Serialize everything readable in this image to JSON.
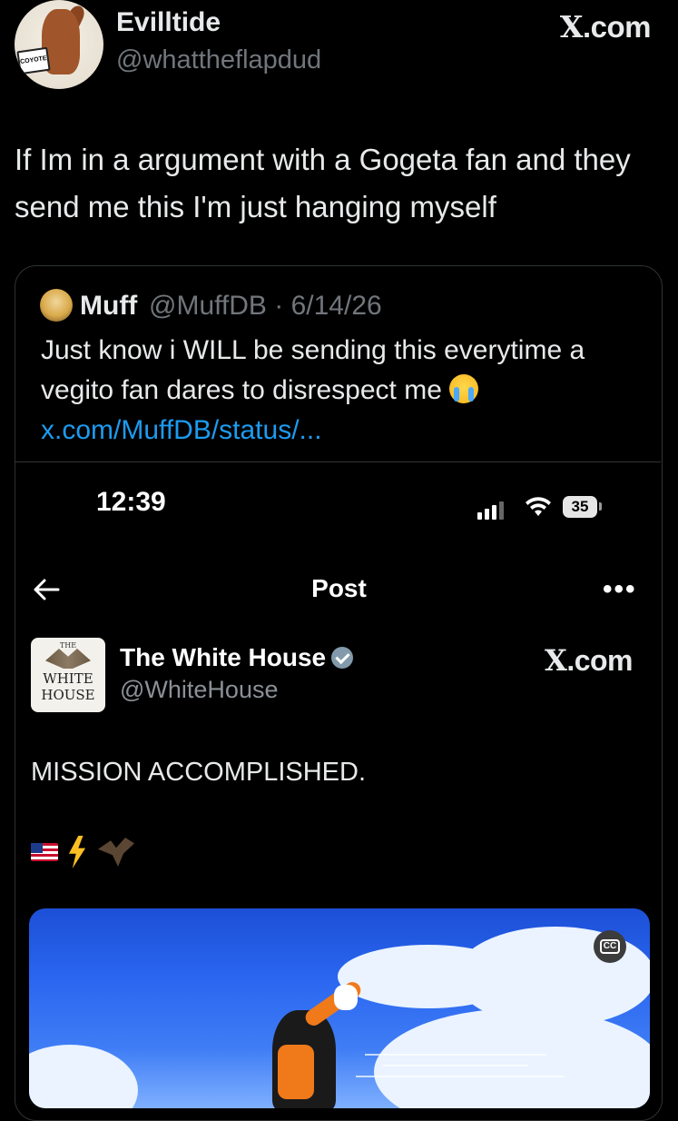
{
  "outer_tweet": {
    "display_name": "Evilltide",
    "handle": "@whattheflapdud",
    "brand": "X.com",
    "text": "If Im in a argument with a Gogeta fan and they send me this I'm just hanging myself",
    "avatar_sign": "COYOTE"
  },
  "quoted_tweet": {
    "display_name": "Muff",
    "handle_date": "@MuffDB · 6/14/26",
    "text": "Just know i WILL be sending this everytime a vegito fan dares to disrespect me ",
    "link": "x.com/MuffDB/status/..."
  },
  "embedded_screenshot": {
    "status_bar": {
      "time": "12:39",
      "battery": "35"
    },
    "nav": {
      "title": "Post"
    },
    "post": {
      "display_name": "The White House",
      "handle": "@WhiteHouse",
      "brand": "X.com",
      "text": "MISSION ACCOMPLISHED.",
      "logo_small": "THE",
      "logo_line1": "WHITE",
      "logo_line2": "HOUSE"
    },
    "video": {
      "captions_label": "CC"
    }
  }
}
